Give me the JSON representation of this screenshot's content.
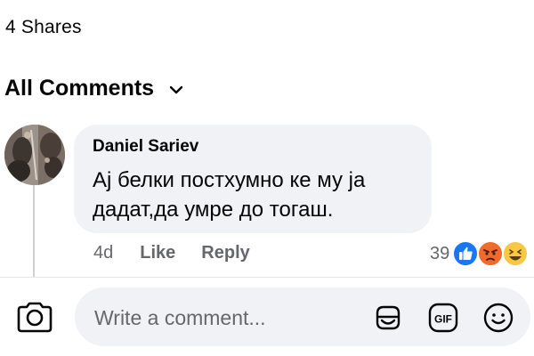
{
  "post_stats": {
    "shares_label": "4 Shares"
  },
  "comments_header": {
    "label": "All Comments",
    "icon": "chevron-down-icon"
  },
  "comment": {
    "author": "Daniel Sariev",
    "text": "Ај белки постхумно ке му ја дадат,да умре до тогаш.",
    "time": "4d",
    "like_label": "Like",
    "reply_label": "Reply",
    "reaction_count": "39",
    "reactions": [
      "like-reaction-icon",
      "angry-reaction-icon",
      "haha-reaction-icon"
    ]
  },
  "composer": {
    "placeholder": "Write a comment...",
    "icons": [
      "camera-icon",
      "sticker-icon",
      "gif-icon",
      "emoji-icon"
    ],
    "gif_label": "GIF"
  },
  "colors": {
    "bubble_bg": "#f0f2f5",
    "secondary_text": "#65676b",
    "like_blue": "#1877f2",
    "angry_orange": "#f06a2b",
    "haha_yellow": "#f7c843"
  }
}
